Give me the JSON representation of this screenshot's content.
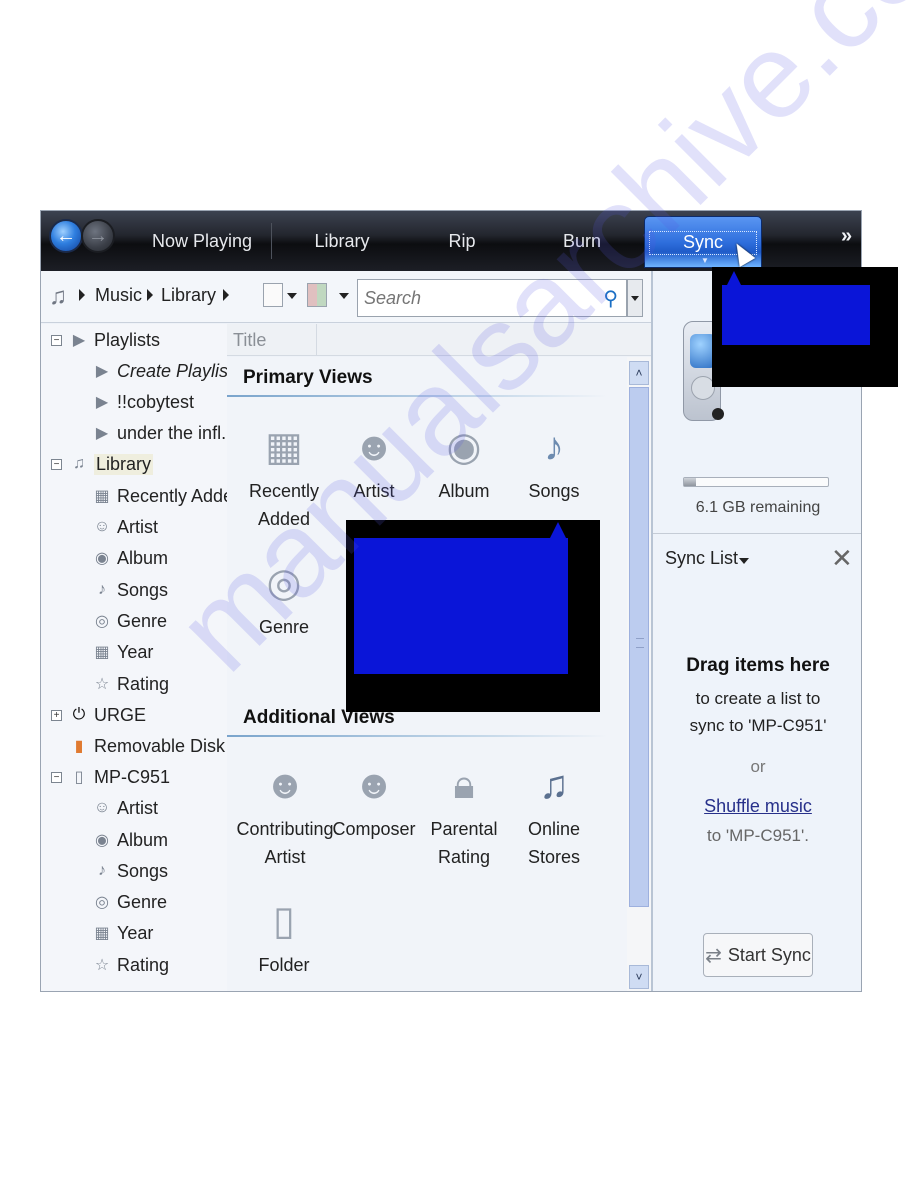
{
  "navbar": {
    "back_icon": "back-arrow-icon",
    "forward_icon": "forward-arrow-icon",
    "back_glyph": "←",
    "forward_glyph": "→",
    "tabs": [
      {
        "label": "Now Playing"
      },
      {
        "label": "Library"
      },
      {
        "label": "Rip"
      },
      {
        "label": "Burn"
      },
      {
        "label": "Sync",
        "active": true
      }
    ],
    "more_glyph": "»"
  },
  "address": {
    "icon": "music-note-icon",
    "icon_glyph": "♫",
    "crumbs": [
      "Music",
      "Library"
    ],
    "search_placeholder": "Search",
    "search_glyph": "⚲"
  },
  "tree": {
    "items": [
      {
        "label": "Playlists",
        "toggle": "−",
        "icon": "▶"
      },
      {
        "label": "Create Playlist",
        "icon": "▶"
      },
      {
        "label": "!!cobytest",
        "icon": "▶"
      },
      {
        "label": "under the infl...",
        "icon": "▶"
      },
      {
        "label": "Library",
        "toggle": "−",
        "icon": "♫"
      },
      {
        "label": "Recently Added",
        "icon": "▦"
      },
      {
        "label": "Artist",
        "icon": "☺"
      },
      {
        "label": "Album",
        "icon": "◉"
      },
      {
        "label": "Songs",
        "icon": "♪"
      },
      {
        "label": "Genre",
        "icon": "◎"
      },
      {
        "label": "Year",
        "icon": "▦"
      },
      {
        "label": "Rating",
        "icon": "☆"
      },
      {
        "label": "URGE",
        "toggle": "+",
        "icon": "⏻"
      },
      {
        "label": "Removable Disk ...",
        "icon": "▮"
      },
      {
        "label": "MP-C951",
        "toggle": "−",
        "icon": "▯"
      },
      {
        "label": "Artist",
        "icon": "☺"
      },
      {
        "label": "Album",
        "icon": "◉"
      },
      {
        "label": "Songs",
        "icon": "♪"
      },
      {
        "label": "Genre",
        "icon": "◎"
      },
      {
        "label": "Year",
        "icon": "▦"
      },
      {
        "label": "Rating",
        "icon": "☆"
      }
    ]
  },
  "columns": {
    "title": "Title"
  },
  "main": {
    "primary_title": "Primary Views",
    "primary": [
      {
        "label": "Recently Added",
        "icon": "▦"
      },
      {
        "label": "Artist",
        "icon": "☻"
      },
      {
        "label": "Album",
        "icon": "◉"
      },
      {
        "label": "Songs",
        "icon": "♪"
      },
      {
        "label": "Genre",
        "icon": "◎"
      }
    ],
    "additional_title": "Additional Views",
    "additional": [
      {
        "label": "Contributing Artist",
        "icon": "☻"
      },
      {
        "label": "Composer",
        "icon": "☻"
      },
      {
        "label": "Parental Rating",
        "icon": "🔒︎"
      },
      {
        "label": "Online Stores",
        "icon": "♫"
      },
      {
        "label": "Folder",
        "icon": "▯"
      }
    ]
  },
  "scrollbar": {
    "up": "˄",
    "down": "˅"
  },
  "sync": {
    "capacity_used_fraction": 0.08,
    "remaining": "6.1 GB remaining",
    "list_label": "Sync List",
    "close_glyph": "✕",
    "drag_title": "Drag items here",
    "drag_sub_1": "to create a list to",
    "drag_sub_2": "sync to 'MP-C951'",
    "or": "or",
    "shuffle_link": "Shuffle music",
    "shuffle_to": "to 'MP-C951'.",
    "start_glyph": "⇄",
    "start_label": "Start Sync"
  },
  "watermark": "manualsarchive.com",
  "colors": {
    "accent": "#2f6fdd",
    "callout_fill": "#0a15d8",
    "callout_border": "#000000"
  }
}
